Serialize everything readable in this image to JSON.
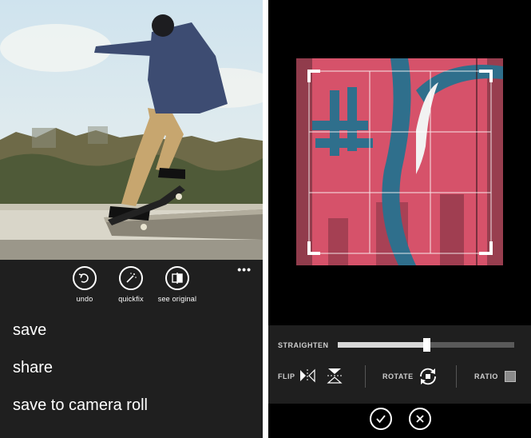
{
  "left_screen": {
    "app_bar": {
      "buttons": [
        {
          "label": "undo",
          "icon": "undo-icon"
        },
        {
          "label": "quickfix",
          "icon": "magic-wand-icon"
        },
        {
          "label": "see original",
          "icon": "compare-icon"
        }
      ],
      "more_glyph": "•••"
    },
    "menu": [
      {
        "label": "save"
      },
      {
        "label": "share"
      },
      {
        "label": "save to camera roll"
      }
    ]
  },
  "right_screen": {
    "tools": {
      "straighten_label": "STRAIGHTEN",
      "straighten_value": 0.5,
      "flip_label": "FLIP",
      "rotate_label": "ROTATE",
      "ratio_label": "RATIO"
    },
    "confirm_icon": "checkmark-icon",
    "cancel_icon": "close-icon"
  },
  "colors": {
    "app_bar_bg": "#1f1f1f",
    "graffiti_pink": "#e0586f",
    "graffiti_blue": "#2f6f8c"
  }
}
